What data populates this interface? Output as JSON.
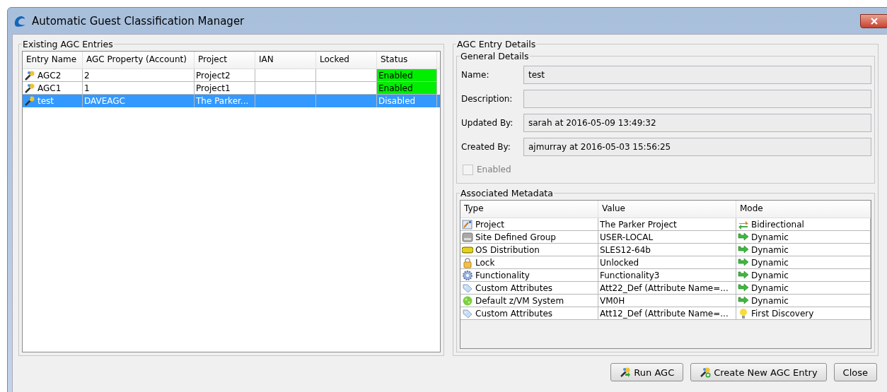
{
  "window": {
    "title": "Automatic Guest Classification Manager"
  },
  "entries": {
    "title": "Existing AGC Entries",
    "columns": [
      "Entry Name",
      "AGC Property (Account)",
      "Project",
      "IAN",
      "Locked",
      "Status"
    ],
    "rows": [
      {
        "name": "AGC2",
        "property": "2",
        "project": "Project2",
        "status": "Enabled",
        "enabled": true,
        "selected": false
      },
      {
        "name": "AGC1",
        "property": "1",
        "project": "Project1",
        "status": "Enabled",
        "enabled": true,
        "selected": false
      },
      {
        "name": "test",
        "property": "DAVEAGC",
        "project": "The Parker...",
        "status": "Disabled",
        "enabled": false,
        "selected": true
      }
    ]
  },
  "details": {
    "title": "AGC Entry Details",
    "general": {
      "title": "General Details",
      "fields": [
        {
          "label": "Name:",
          "value": "test"
        },
        {
          "label": "Description:"
        },
        {
          "label": "Updated By:",
          "value": "sarah at 2016-05-09 13:49:32"
        },
        {
          "label": "Created By:",
          "value": "ajmurray at 2016-05-03 15:56:25"
        }
      ],
      "enabled": {
        "label": "Enabled",
        "checked": false,
        "disabled": true
      }
    },
    "metadata": {
      "title": "Associated Metadata",
      "columns": [
        "Type",
        "Value",
        "Mode"
      ],
      "rows": [
        {
          "type": {
            "text": "Project",
            "kind": "project"
          },
          "value": "The Parker Project",
          "mode": {
            "text": "Bidirectional",
            "kind": "bidirectional"
          }
        },
        {
          "type": {
            "text": "Site Defined Group",
            "kind": "group"
          },
          "value": "USER-LOCAL",
          "mode": {
            "text": "Dynamic",
            "kind": "dynamic"
          }
        },
        {
          "type": {
            "text": "OS Distribution",
            "kind": "os"
          },
          "value": "SLES12-64b",
          "mode": {
            "text": "Dynamic",
            "kind": "dynamic"
          }
        },
        {
          "type": {
            "text": "Lock",
            "kind": "lock"
          },
          "value": "Unlocked",
          "mode": {
            "text": "Dynamic",
            "kind": "dynamic"
          }
        },
        {
          "type": {
            "text": "Functionality",
            "kind": "functionality"
          },
          "value": "Functionality3",
          "mode": {
            "text": "Dynamic",
            "kind": "dynamic"
          }
        },
        {
          "type": {
            "text": "Custom Attributes",
            "kind": "attribute"
          },
          "value": "Att22_Def (Attribute Name=...",
          "mode": {
            "text": "Dynamic",
            "kind": "dynamic"
          }
        },
        {
          "type": {
            "text": "Default z/VM System",
            "kind": "system"
          },
          "value": "VM0H",
          "mode": {
            "text": "Dynamic",
            "kind": "dynamic"
          }
        },
        {
          "type": {
            "text": "Custom Attributes",
            "kind": "attribute"
          },
          "value": "Att12_Def (Attribute Name=...",
          "mode": {
            "text": "First Discovery",
            "kind": "discovery"
          }
        }
      ]
    }
  },
  "buttons": [
    {
      "label": "Run AGC",
      "kind": "run"
    },
    {
      "label": "Create New AGC Entry",
      "kind": "create"
    },
    {
      "label": "Close",
      "kind": "plain"
    }
  ]
}
